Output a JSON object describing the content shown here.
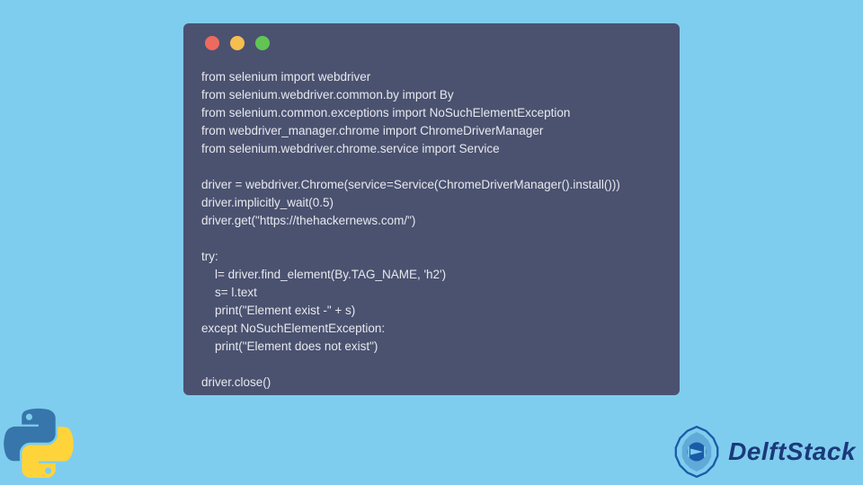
{
  "code": {
    "lines": [
      "from selenium import webdriver",
      "from selenium.webdriver.common.by import By",
      "from selenium.common.exceptions import NoSuchElementException",
      "from webdriver_manager.chrome import ChromeDriverManager",
      "from selenium.webdriver.chrome.service import Service",
      "",
      "driver = webdriver.Chrome(service=Service(ChromeDriverManager().install()))",
      "driver.implicitly_wait(0.5)",
      "driver.get(\"https://thehackernews.com/\")",
      "",
      "try:",
      "    l= driver.find_element(By.TAG_NAME, 'h2')",
      "    s= l.text",
      "    print(\"Element exist -\" + s)",
      "except NoSuchElementException:",
      "    print(\"Element does not exist\")",
      "",
      "driver.close()"
    ]
  },
  "brand": {
    "name": "DelftStack"
  },
  "traffic_lights": {
    "red": "#ed6a5e",
    "yellow": "#f5bf4f",
    "green": "#61c554"
  }
}
